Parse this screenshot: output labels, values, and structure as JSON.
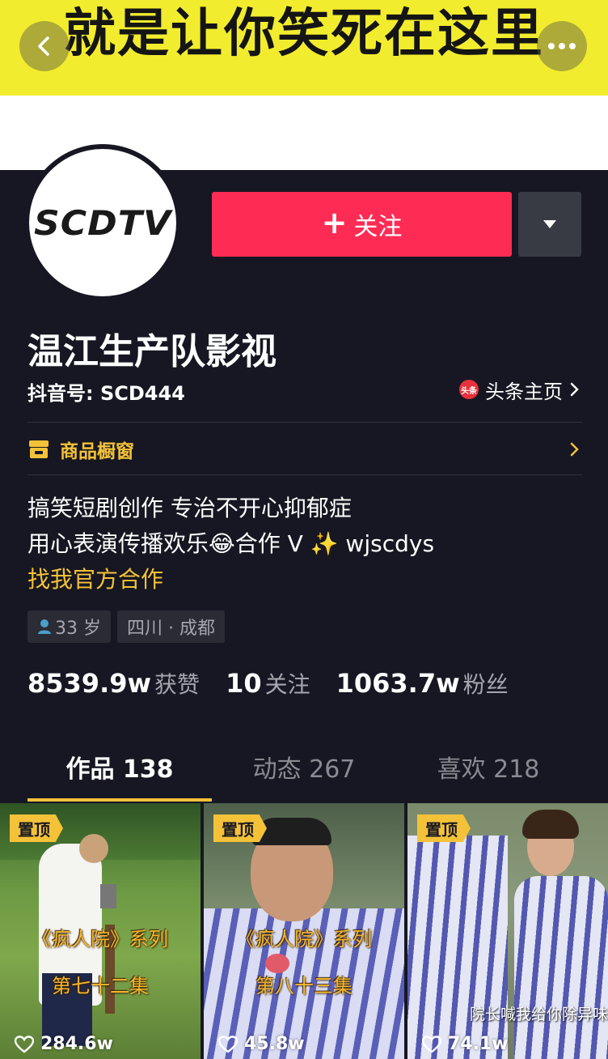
{
  "banner": {
    "text": "就是让你笑死在这里"
  },
  "nav": {
    "back_icon": "chevron-left-icon",
    "more_icon": "more-dots-icon"
  },
  "profile": {
    "avatar_text": "SCDTV",
    "follow_label": "关注",
    "username": "温江生产队影视",
    "douyin_id": "抖音号: SCD444",
    "toutiao_badge": "头条",
    "toutiao_label": "头条主页",
    "shop_label": "商品橱窗",
    "bio_line1": "搞笑短剧创作 专治不开心抑郁症",
    "bio_line2": "用心表演传播欢乐😂合作 V ✨ wjscdys",
    "bio_link": "找我官方合作",
    "tag_age": "33 岁",
    "tag_location": "四川 · 成都"
  },
  "stats": {
    "likes_num": "8539.9w",
    "likes_label": "获赞",
    "following_num": "10",
    "following_label": "关注",
    "followers_num": "1063.7w",
    "followers_label": "粉丝"
  },
  "tabs": [
    {
      "label": "作品 138",
      "active": true
    },
    {
      "label": "动态 267",
      "active": false
    },
    {
      "label": "喜欢 218",
      "active": false
    }
  ],
  "videos": [
    {
      "pin": "置顶",
      "caption1": "《疯人院》系列",
      "caption2": "第七十二集",
      "likes": "284.6w"
    },
    {
      "pin": "置顶",
      "caption1": "《疯人院》系列",
      "caption2": "第八十三集",
      "likes": "45.8w"
    },
    {
      "pin": "置顶",
      "caption1": "院长喊我给你除异味",
      "likes": "74.1w"
    }
  ],
  "colors": {
    "accent": "#fe2c55",
    "gold": "#f4c238",
    "background": "#161722"
  }
}
